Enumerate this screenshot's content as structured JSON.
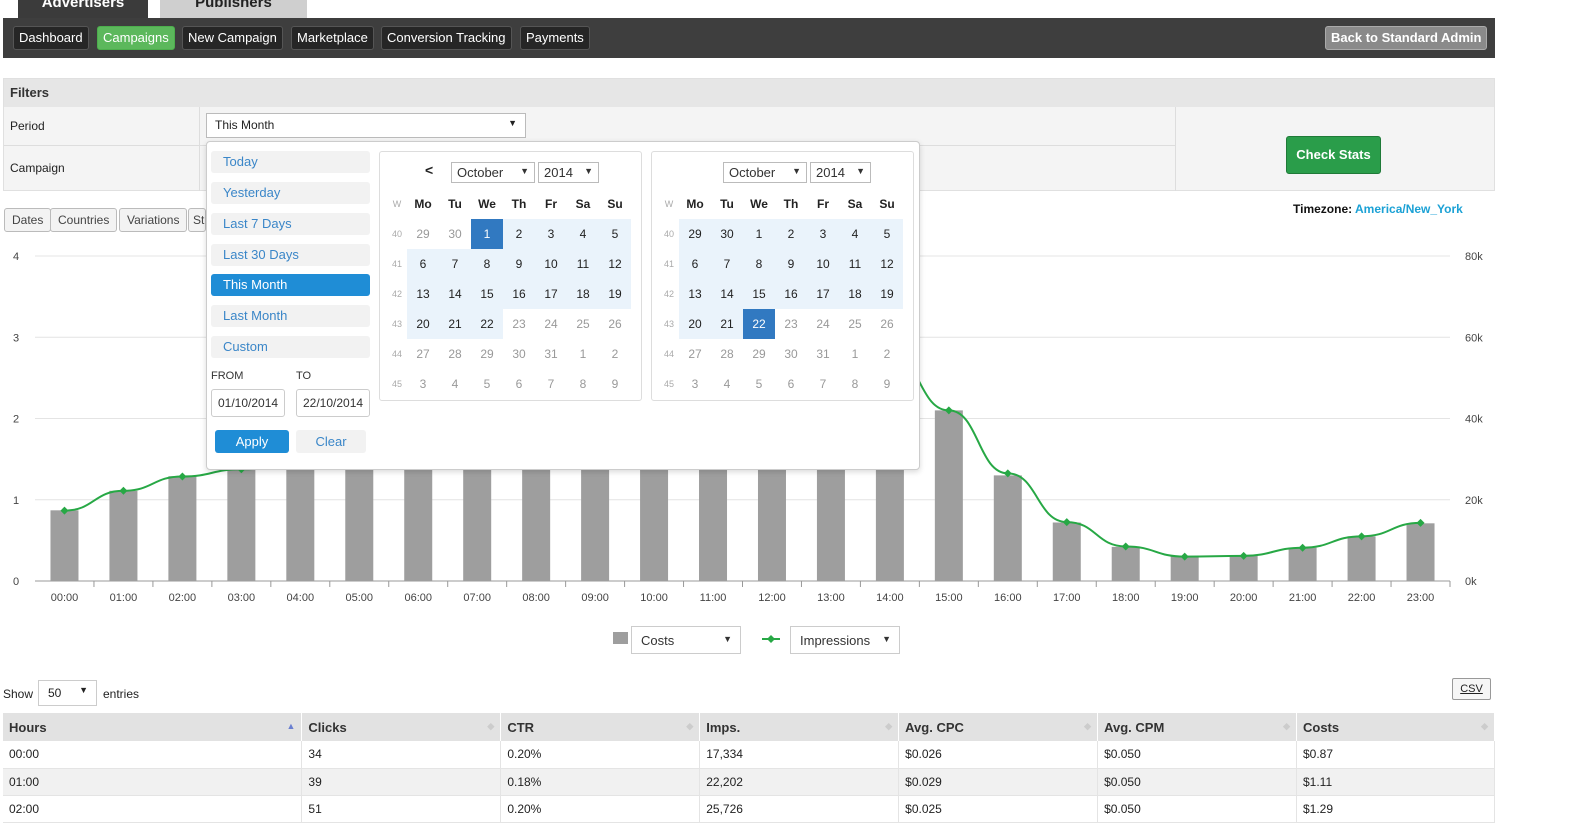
{
  "top_tabs": [
    "Advertisers",
    "Publishers"
  ],
  "nav": {
    "items": [
      "Dashboard",
      "Campaigns",
      "New Campaign",
      "Marketplace",
      "Conversion Tracking",
      "Payments"
    ],
    "active": "Campaigns",
    "back_label": "Back to Standard Admin"
  },
  "filters": {
    "title": "Filters",
    "period_label": "Period",
    "period_value": "This Month",
    "campaign_label": "Campaign",
    "check_stats": "Check Stats"
  },
  "sub_tabs": [
    "Dates",
    "Countries",
    "Variations",
    "St"
  ],
  "timezone": {
    "label": "Timezone:",
    "value": "America/New_York"
  },
  "picker": {
    "ranges": [
      "Today",
      "Yesterday",
      "Last 7 Days",
      "Last 30 Days",
      "This Month",
      "Last Month",
      "Custom"
    ],
    "active_range": "This Month",
    "from_label": "FROM",
    "to_label": "TO",
    "from_value": "01/10/2014",
    "to_value": "22/10/2014",
    "apply": "Apply",
    "clear": "Clear",
    "prev": "<",
    "week_header": "W",
    "day_headers": [
      "Mo",
      "Tu",
      "We",
      "Th",
      "Fr",
      "Sa",
      "Su"
    ],
    "left_calendar": {
      "month": "October",
      "year": "2014",
      "weeks": [
        40,
        41,
        42,
        43,
        44,
        45
      ],
      "days": [
        [
          "29",
          "30",
          "1",
          "2",
          "3",
          "4",
          "5"
        ],
        [
          "6",
          "7",
          "8",
          "9",
          "10",
          "11",
          "12"
        ],
        [
          "13",
          "14",
          "15",
          "16",
          "17",
          "18",
          "19"
        ],
        [
          "20",
          "21",
          "22",
          "23",
          "24",
          "25",
          "26"
        ],
        [
          "27",
          "28",
          "29",
          "30",
          "31",
          "1",
          "2"
        ],
        [
          "3",
          "4",
          "5",
          "6",
          "7",
          "8",
          "9"
        ]
      ]
    },
    "right_calendar": {
      "month": "October",
      "year": "2014",
      "weeks": [
        40,
        41,
        42,
        43,
        44,
        45
      ],
      "days": [
        [
          "29",
          "30",
          "1",
          "2",
          "3",
          "4",
          "5"
        ],
        [
          "6",
          "7",
          "8",
          "9",
          "10",
          "11",
          "12"
        ],
        [
          "13",
          "14",
          "15",
          "16",
          "17",
          "18",
          "19"
        ],
        [
          "20",
          "21",
          "22",
          "23",
          "24",
          "25",
          "26"
        ],
        [
          "27",
          "28",
          "29",
          "30",
          "31",
          "1",
          "2"
        ],
        [
          "3",
          "4",
          "5",
          "6",
          "7",
          "8",
          "9"
        ]
      ]
    }
  },
  "chart_data": {
    "type": "bar",
    "categories": [
      "00:00",
      "01:00",
      "02:00",
      "03:00",
      "04:00",
      "05:00",
      "06:00",
      "07:00",
      "08:00",
      "09:00",
      "10:00",
      "11:00",
      "12:00",
      "13:00",
      "14:00",
      "15:00",
      "16:00",
      "17:00",
      "18:00",
      "19:00",
      "20:00",
      "21:00",
      "22:00",
      "23:00"
    ],
    "series": [
      {
        "name": "Costs",
        "kind": "bar",
        "axis": "left",
        "values": [
          0.87,
          1.11,
          1.29,
          1.4,
          1.5,
          1.55,
          1.6,
          1.62,
          1.6,
          1.58,
          1.55,
          1.5,
          1.5,
          1.55,
          1.7,
          2.1,
          1.3,
          0.72,
          0.42,
          0.31,
          0.31,
          0.41,
          0.55,
          0.71
        ]
      },
      {
        "name": "Impressions",
        "kind": "line",
        "axis": "right",
        "values": [
          17334,
          22202,
          25726,
          27500,
          28500,
          30000,
          32000,
          34000,
          36000,
          38000,
          41000,
          45000,
          50000,
          55000,
          56000,
          42000,
          26500,
          14500,
          8500,
          6000,
          6200,
          8200,
          11000,
          14300
        ]
      }
    ],
    "left_axis": {
      "ylim": [
        0,
        4
      ],
      "ticks": [
        "0",
        "1",
        "2",
        "3",
        "4"
      ]
    },
    "right_axis": {
      "ylim": [
        0,
        80000
      ],
      "ticks": [
        "0k",
        "20k",
        "40k",
        "60k",
        "80k"
      ]
    },
    "colors": {
      "bar": "#9e9e9e",
      "line": "#27a845"
    }
  },
  "legend": {
    "costs_select": "Costs",
    "impressions_select": "Impressions"
  },
  "entries": {
    "show": "Show",
    "value": "50",
    "suffix": "entries",
    "csv": "CSV"
  },
  "table": {
    "headers": [
      "Hours",
      "Clicks",
      "CTR",
      "Imps.",
      "Avg. CPC",
      "Avg. CPM",
      "Costs"
    ],
    "rows": [
      [
        "00:00",
        "34",
        "0.20%",
        "17,334",
        "$0.026",
        "$0.050",
        "$0.87"
      ],
      [
        "01:00",
        "39",
        "0.18%",
        "22,202",
        "$0.029",
        "$0.050",
        "$1.11"
      ],
      [
        "02:00",
        "51",
        "0.20%",
        "25,726",
        "$0.025",
        "$0.050",
        "$1.29"
      ]
    ]
  }
}
